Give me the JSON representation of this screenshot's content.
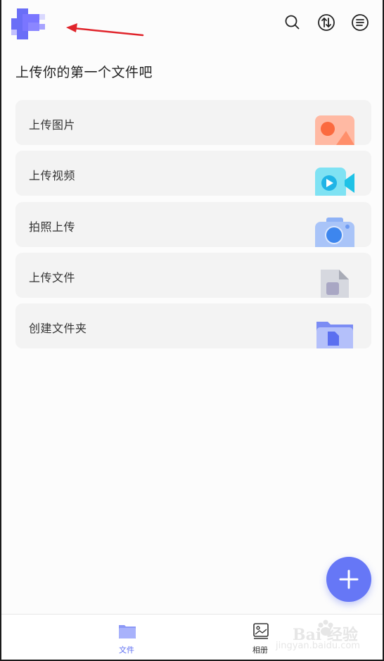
{
  "header": {
    "icons": [
      "search-icon",
      "sync-icon",
      "menu-icon"
    ]
  },
  "main": {
    "title": "上传你的第一个文件吧",
    "cards": [
      {
        "label": "上传图片",
        "icon": "image-icon"
      },
      {
        "label": "上传视频",
        "icon": "video-icon"
      },
      {
        "label": "拍照上传",
        "icon": "camera-icon"
      },
      {
        "label": "上传文件",
        "icon": "document-icon"
      },
      {
        "label": "创建文件夹",
        "icon": "folder-icon"
      }
    ]
  },
  "fab": {
    "icon": "plus-icon",
    "color": "#6677f6"
  },
  "bottom_nav": {
    "items": [
      {
        "label": "文件",
        "icon": "folder-icon",
        "active": true
      },
      {
        "label": "相册",
        "icon": "album-icon",
        "active": false
      }
    ],
    "active_color": "#5c6df2"
  },
  "watermark": {
    "text": "Bai 经验",
    "sub": "jingyan.baidu.com"
  }
}
